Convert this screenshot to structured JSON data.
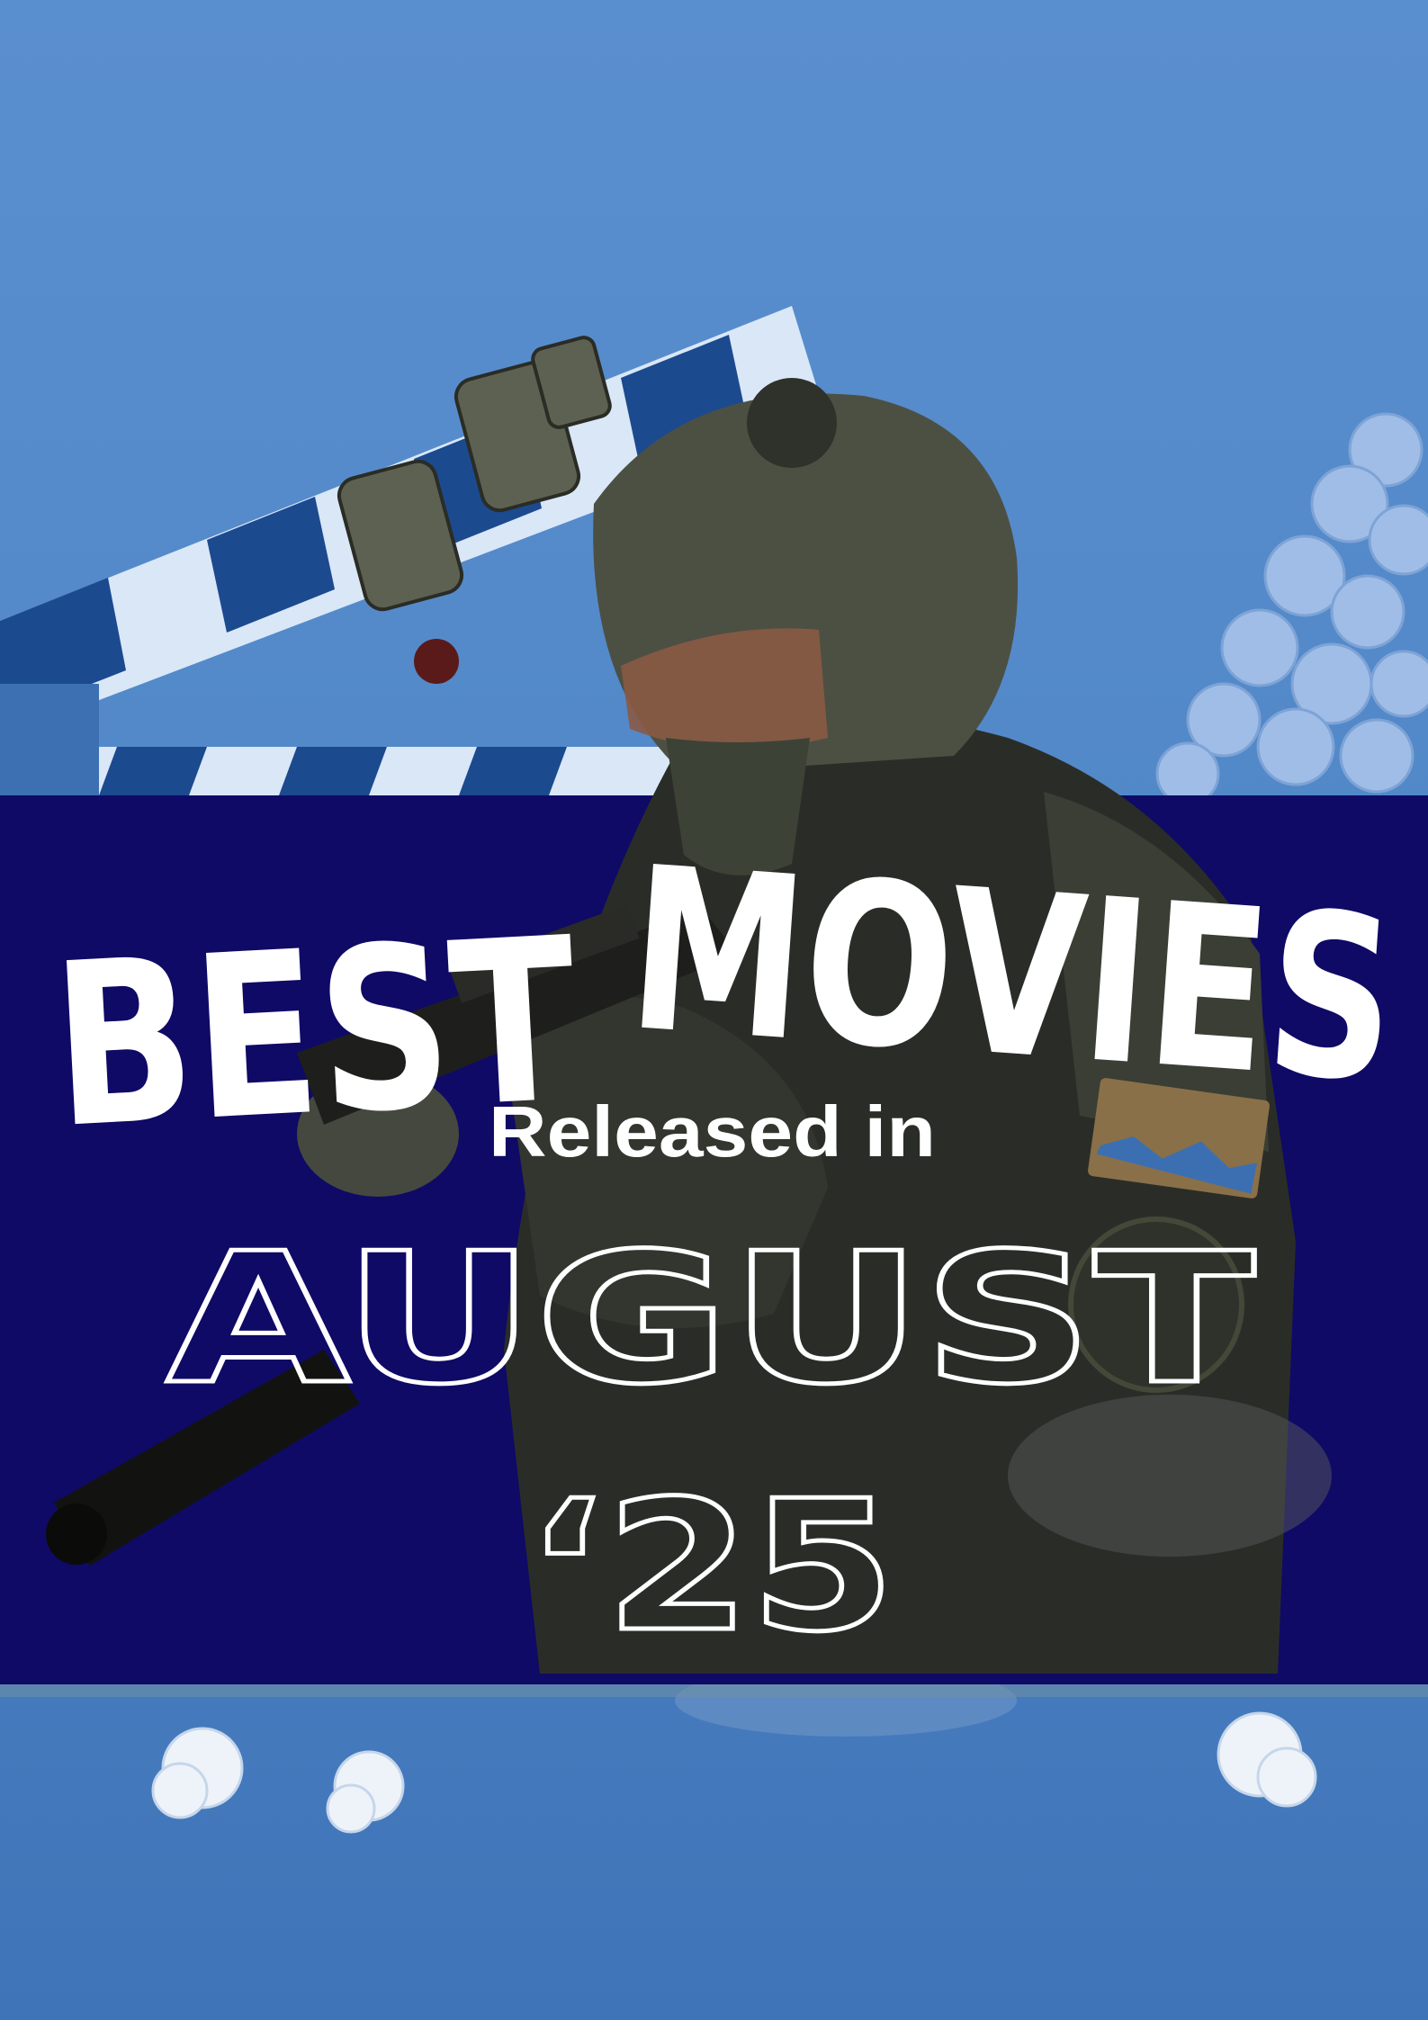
{
  "poster": {
    "headline": "BEST MOVIES",
    "headline_word_1": "BEST",
    "headline_word_2": "MOVIES",
    "subheading": "Released in",
    "month": "AUGUST",
    "year": "‘25"
  },
  "colors": {
    "background": "#4f86c7",
    "band": "#0f0a66",
    "text": "#ffffff",
    "clapper_dark": "#1c4a8f",
    "clapper_light": "#d8e6f6"
  },
  "illustration": {
    "main_subject": "soldier-with-rifle",
    "background_props": [
      "clapperboard",
      "popcorn-pile",
      "popcorn-kernels"
    ]
  }
}
